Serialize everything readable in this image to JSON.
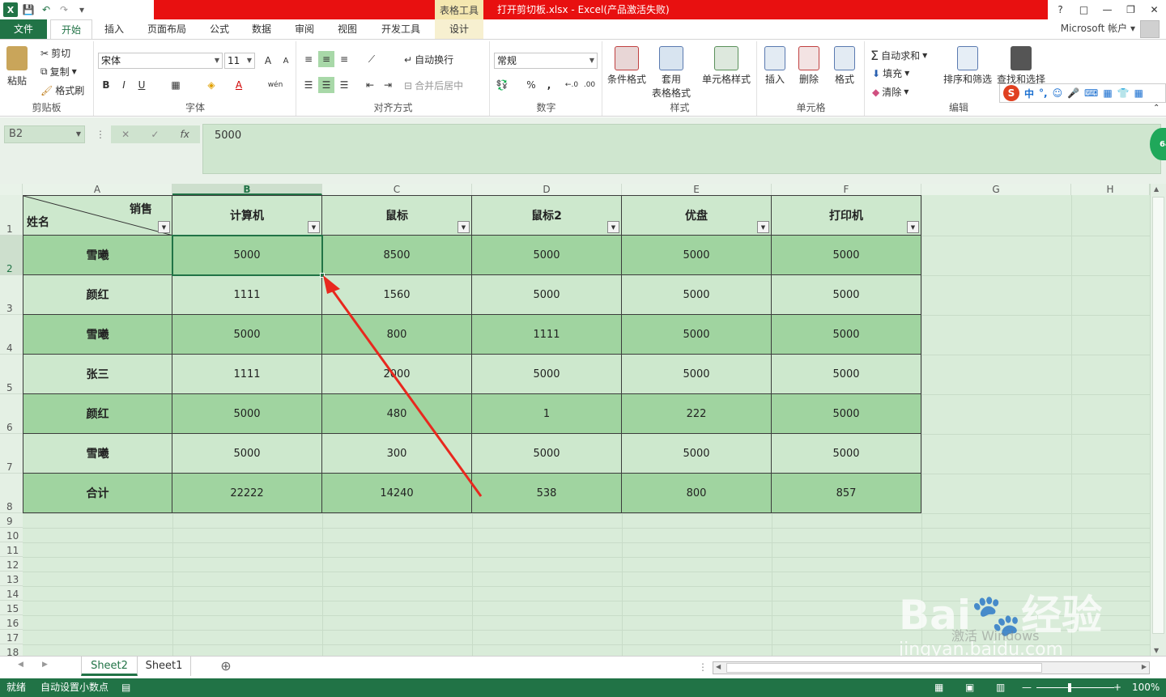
{
  "titlebar": {
    "context_tab": "表格工具",
    "title": "打开剪切板.xlsx -  Excel(产品激活失败)",
    "help": "?",
    "restore_ribbon": "□",
    "minimize": "—",
    "maximize": "❐",
    "close": "✕"
  },
  "tabs": {
    "file": "文件",
    "home": "开始",
    "insert": "插入",
    "page_layout": "页面布局",
    "formulas": "公式",
    "data": "数据",
    "review": "审阅",
    "view": "视图",
    "developer": "开发工具",
    "design": "设计",
    "account": "Microsoft 帐户"
  },
  "ribbon": {
    "clipboard": {
      "paste": "粘贴",
      "cut": "剪切",
      "copy": "复制",
      "format_painter": "格式刷",
      "label": "剪贴板"
    },
    "font": {
      "name": "宋体",
      "size": "11",
      "label": "字体",
      "bold": "B",
      "italic": "I",
      "underline": "U",
      "grow": "A",
      "shrink": "A",
      "font_color": "A",
      "phonetic": "wén"
    },
    "alignment": {
      "wrap": "自动换行",
      "merge": "合并后居中",
      "label": "对齐方式"
    },
    "number": {
      "format": "常规",
      "percent": "%",
      "comma": ",",
      "label": "数字"
    },
    "styles": {
      "conditional": "条件格式",
      "table_format_1": "套用",
      "table_format_2": "表格格式",
      "cell_styles": "单元格样式",
      "label": "样式"
    },
    "cells": {
      "insert": "插入",
      "delete": "删除",
      "format": "格式",
      "label": "单元格"
    },
    "editing": {
      "autosum": "自动求和",
      "fill": "填充",
      "clear": "清除",
      "sort": "排序和筛选",
      "find": "查找和选择",
      "label": "编辑"
    }
  },
  "formula_bar": {
    "name_box": "B2",
    "separator": "⋮",
    "cancel": "✕",
    "enter": "✓",
    "fx": "fx",
    "value": "5000"
  },
  "columns": [
    "A",
    "B",
    "C",
    "D",
    "E",
    "F",
    "G",
    "H"
  ],
  "rows": [
    "1",
    "2",
    "3",
    "4",
    "5",
    "6",
    "7",
    "8",
    "9",
    "10",
    "11",
    "12",
    "13",
    "14",
    "15",
    "16",
    "17",
    "18"
  ],
  "table": {
    "corner_top": "销售",
    "corner_bottom": "姓名",
    "headers": [
      "计算机",
      "鼠标",
      "鼠标2",
      "优盘",
      "打印机"
    ],
    "body": [
      {
        "name": "雪曦",
        "values": [
          "5000",
          "8500",
          "5000",
          "5000",
          "5000"
        ]
      },
      {
        "name": "颜红",
        "values": [
          "1111",
          "1560",
          "5000",
          "5000",
          "5000"
        ]
      },
      {
        "name": "雪曦",
        "values": [
          "5000",
          "800",
          "1111",
          "5000",
          "5000"
        ]
      },
      {
        "name": "张三",
        "values": [
          "1111",
          "2000",
          "5000",
          "5000",
          "5000"
        ]
      },
      {
        "name": "颜红",
        "values": [
          "5000",
          "480",
          "1",
          "222",
          "5000"
        ]
      },
      {
        "name": "雪曦",
        "values": [
          "5000",
          "300",
          "5000",
          "5000",
          "5000"
        ]
      },
      {
        "name": "合计",
        "values": [
          "22222",
          "14240",
          "538",
          "800",
          "857"
        ]
      }
    ]
  },
  "sheet_tabs": [
    "Sheet2",
    "Sheet1"
  ],
  "add_sheet": "⊕",
  "status": {
    "ready": "就绪",
    "auto_decimal": "自动设置小数点",
    "zoom": "100%"
  },
  "ime": {
    "logo": "S",
    "mode": "中",
    "punct": "°,"
  },
  "watermark": {
    "brand": "Bai",
    "brand_suffix": "经验",
    "url": "jingyan.baidu.com",
    "activate": "激活 Windows"
  },
  "badge": "64",
  "colors": {
    "excel_green": "#217346",
    "title_red": "#e81010",
    "band_dark": "#a0d4a0",
    "band_light": "#cde8cd",
    "arrow_red": "#e8281e"
  }
}
